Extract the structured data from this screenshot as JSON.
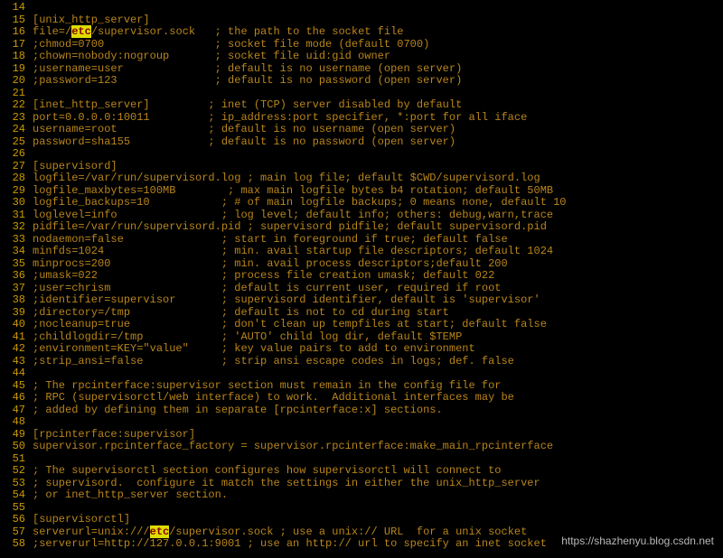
{
  "watermark": "https://shazhenyu.blog.csdn.net",
  "highlight_token": "etc",
  "lines": [
    {
      "n": 14,
      "segs": [
        {
          "t": ""
        }
      ]
    },
    {
      "n": 15,
      "segs": [
        {
          "t": "[unix_http_server]"
        }
      ]
    },
    {
      "n": 16,
      "segs": [
        {
          "t": "file=/"
        },
        {
          "t": "etc",
          "hl": true
        },
        {
          "t": "/supervisor.sock   ; the path to the socket file"
        }
      ]
    },
    {
      "n": 17,
      "segs": [
        {
          "t": ";chmod=0700                 ; socket file mode (default 0700)"
        }
      ]
    },
    {
      "n": 18,
      "segs": [
        {
          "t": ";chown=nobody:nogroup       ; socket file uid:gid owner"
        }
      ]
    },
    {
      "n": 19,
      "segs": [
        {
          "t": ";username=user              ; default is no username (open server)"
        }
      ]
    },
    {
      "n": 20,
      "segs": [
        {
          "t": ";password=123               ; default is no password (open server)"
        }
      ]
    },
    {
      "n": 21,
      "segs": [
        {
          "t": ""
        }
      ]
    },
    {
      "n": 22,
      "segs": [
        {
          "t": "[inet_http_server]         ; inet (TCP) server disabled by default"
        }
      ]
    },
    {
      "n": 23,
      "segs": [
        {
          "t": "port=0.0.0.0:10011         ; ip_address:port specifier, *:port for all iface"
        }
      ]
    },
    {
      "n": 24,
      "segs": [
        {
          "t": "username=root              ; default is no username (open server)"
        }
      ]
    },
    {
      "n": 25,
      "segs": [
        {
          "t": "password=sha155            ; default is no password (open server)"
        }
      ]
    },
    {
      "n": 26,
      "segs": [
        {
          "t": ""
        }
      ]
    },
    {
      "n": 27,
      "segs": [
        {
          "t": "[supervisord]"
        }
      ]
    },
    {
      "n": 28,
      "segs": [
        {
          "t": "logfile=/var/run/supervisord.log ; main log file; default $CWD/supervisord.log"
        }
      ]
    },
    {
      "n": 29,
      "segs": [
        {
          "t": "logfile_maxbytes=100MB        ; max main logfile bytes b4 rotation; default 50MB"
        }
      ]
    },
    {
      "n": 30,
      "segs": [
        {
          "t": "logfile_backups=10           ; # of main logfile backups; 0 means none, default 10"
        }
      ]
    },
    {
      "n": 31,
      "segs": [
        {
          "t": "loglevel=info                ; log level; default info; others: debug,warn,trace"
        }
      ]
    },
    {
      "n": 32,
      "segs": [
        {
          "t": "pidfile=/var/run/supervisord.pid ; supervisord pidfile; default supervisord.pid"
        }
      ]
    },
    {
      "n": 33,
      "segs": [
        {
          "t": "nodaemon=false               ; start in foreground if true; default false"
        }
      ]
    },
    {
      "n": 34,
      "segs": [
        {
          "t": "minfds=1024                  ; min. avail startup file descriptors; default 1024"
        }
      ]
    },
    {
      "n": 35,
      "segs": [
        {
          "t": "minprocs=200                 ; min. avail process descriptors;default 200"
        }
      ]
    },
    {
      "n": 36,
      "segs": [
        {
          "t": ";umask=022                   ; process file creation umask; default 022"
        }
      ]
    },
    {
      "n": 37,
      "segs": [
        {
          "t": ";user=chrism                 ; default is current user, required if root"
        }
      ]
    },
    {
      "n": 38,
      "segs": [
        {
          "t": ";identifier=supervisor       ; supervisord identifier, default is 'supervisor'"
        }
      ]
    },
    {
      "n": 39,
      "segs": [
        {
          "t": ";directory=/tmp              ; default is not to cd during start"
        }
      ]
    },
    {
      "n": 40,
      "segs": [
        {
          "t": ";nocleanup=true              ; don't clean up tempfiles at start; default false"
        }
      ]
    },
    {
      "n": 41,
      "segs": [
        {
          "t": ";childlogdir=/tmp            ; 'AUTO' child log dir, default $TEMP"
        }
      ]
    },
    {
      "n": 42,
      "segs": [
        {
          "t": ";environment=KEY=\"value\"     ; key value pairs to add to environment"
        }
      ]
    },
    {
      "n": 43,
      "segs": [
        {
          "t": ";strip_ansi=false            ; strip ansi escape codes in logs; def. false"
        }
      ]
    },
    {
      "n": 44,
      "segs": [
        {
          "t": ""
        }
      ]
    },
    {
      "n": 45,
      "segs": [
        {
          "t": "; The rpcinterface:supervisor section must remain in the config file for"
        }
      ]
    },
    {
      "n": 46,
      "segs": [
        {
          "t": "; RPC (supervisorctl/web interface) to work.  Additional interfaces may be"
        }
      ]
    },
    {
      "n": 47,
      "segs": [
        {
          "t": "; added by defining them in separate [rpcinterface:x] sections."
        }
      ]
    },
    {
      "n": 48,
      "segs": [
        {
          "t": ""
        }
      ]
    },
    {
      "n": 49,
      "segs": [
        {
          "t": "[rpcinterface:supervisor]"
        }
      ]
    },
    {
      "n": 50,
      "segs": [
        {
          "t": "supervisor.rpcinterface_factory = supervisor.rpcinterface:make_main_rpcinterface"
        }
      ]
    },
    {
      "n": 51,
      "segs": [
        {
          "t": ""
        }
      ]
    },
    {
      "n": 52,
      "segs": [
        {
          "t": "; The supervisorctl section configures how supervisorctl will connect to"
        }
      ]
    },
    {
      "n": 53,
      "segs": [
        {
          "t": "; supervisord.  configure it match the settings in either the unix_http_server"
        }
      ]
    },
    {
      "n": 54,
      "segs": [
        {
          "t": "; or inet_http_server section."
        }
      ]
    },
    {
      "n": 55,
      "segs": [
        {
          "t": ""
        }
      ]
    },
    {
      "n": 56,
      "segs": [
        {
          "t": "[supervisorctl]"
        }
      ]
    },
    {
      "n": 57,
      "segs": [
        {
          "t": "serverurl=unix:///"
        },
        {
          "t": "etc",
          "hl": true
        },
        {
          "t": "/supervisor.sock ; use a unix:// URL  for a unix socket"
        }
      ]
    },
    {
      "n": 58,
      "segs": [
        {
          "t": ";serverurl=http://127.0.0.1:9001 ; use an http:// url to specify an inet socket"
        }
      ]
    }
  ]
}
